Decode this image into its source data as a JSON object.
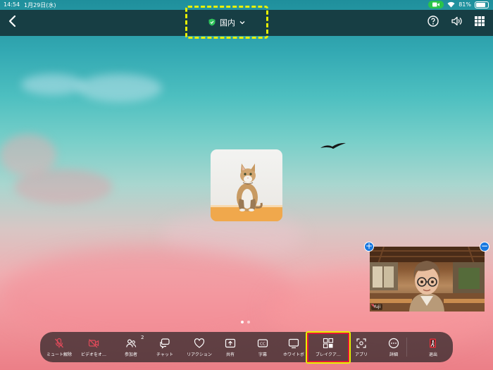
{
  "status": {
    "time": "14:54",
    "date": "1月29日(水)",
    "battery": "81%",
    "battery_level": 0.81
  },
  "topbar": {
    "title": "国内"
  },
  "self_video": {
    "name": "Yuji"
  },
  "pager": {
    "pages": 2,
    "current": 1
  },
  "toolbar": {
    "unmute": "ミュート解除",
    "video": "ビデオをオ…",
    "participants": "参加者",
    "participants_count": "2",
    "chat": "チャット",
    "reaction": "リアクション",
    "share": "共有",
    "captions": "字幕",
    "whiteboard": "ホワイトボ",
    "breakout": "ブレイクア…",
    "apps": "アプリ",
    "more": "詳細",
    "leave": "退出"
  },
  "colors": {
    "accent_highlight": "#e8f000",
    "selected_border": "#e2183a",
    "mic_muted": "#e04a5a",
    "leave_red": "#e0303a"
  }
}
